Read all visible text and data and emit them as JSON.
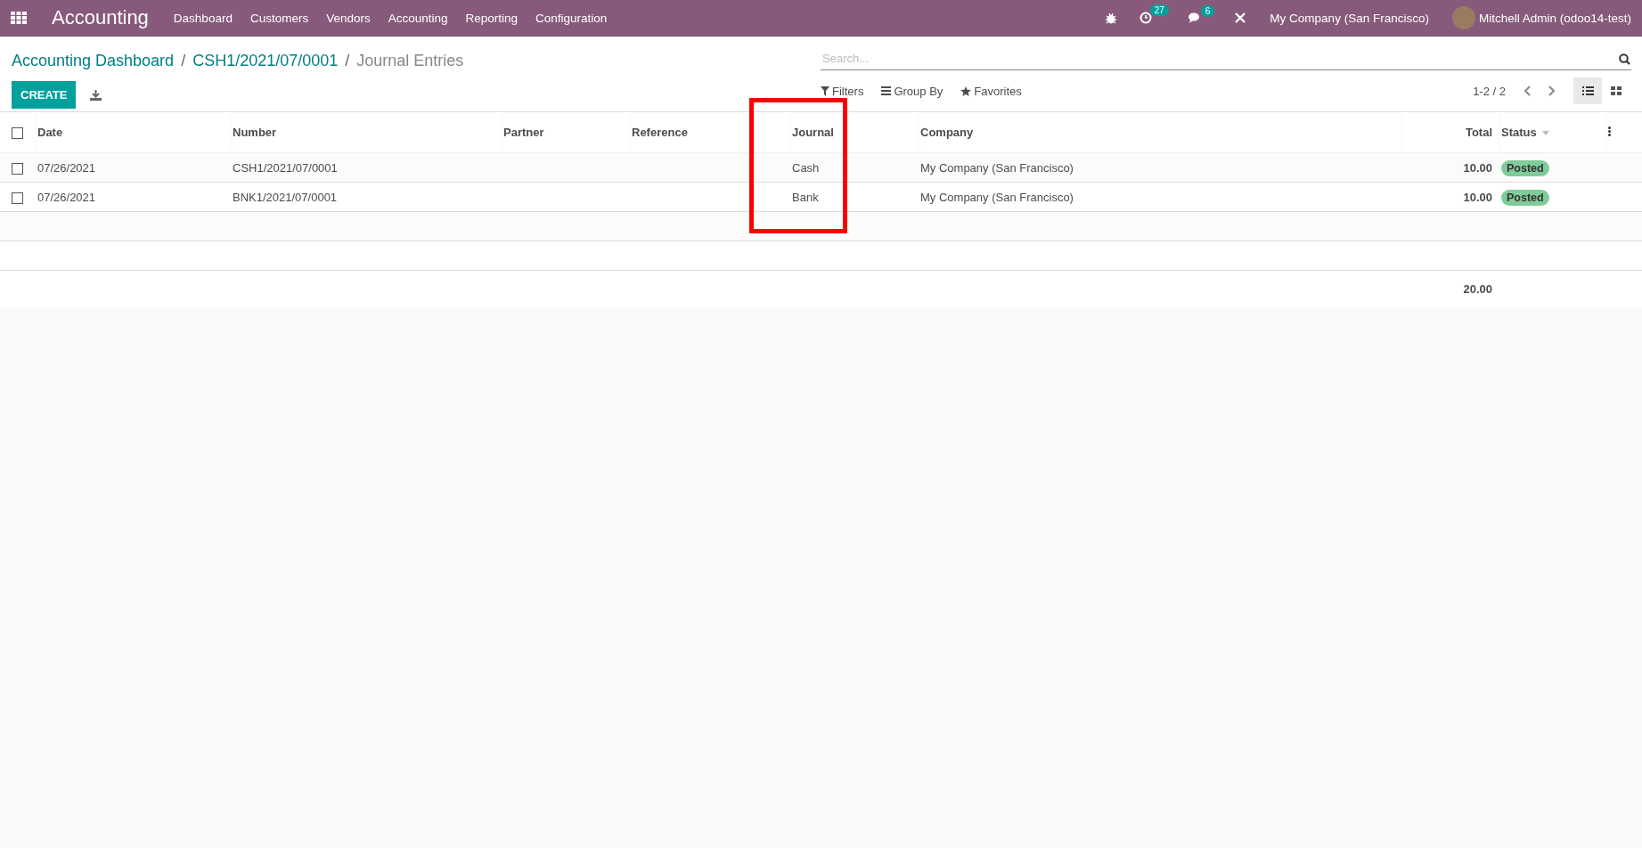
{
  "navbar": {
    "app_title": "Accounting",
    "menu": [
      {
        "label": "Dashboard"
      },
      {
        "label": "Customers"
      },
      {
        "label": "Vendors"
      },
      {
        "label": "Accounting"
      },
      {
        "label": "Reporting"
      },
      {
        "label": "Configuration"
      }
    ],
    "activity_count": "27",
    "message_count": "6",
    "company": "My Company (San Francisco)",
    "user": "Mitchell Admin (odoo14-test)"
  },
  "breadcrumb": {
    "separator": "/",
    "items": [
      {
        "label": "Accounting Dashboard",
        "kind": "link"
      },
      {
        "label": "CSH1/2021/07/0001",
        "kind": "link"
      },
      {
        "label": "Journal Entries",
        "kind": "current"
      }
    ]
  },
  "create_button": "CREATE",
  "search": {
    "placeholder": "Search..."
  },
  "search_options": [
    {
      "label": "Filters",
      "kind": "filter"
    },
    {
      "label": "Group By",
      "kind": "group"
    },
    {
      "label": "Favorites",
      "kind": "star"
    }
  ],
  "pager": "1-2 / 2",
  "views": [
    {
      "kind": "list",
      "selected": true
    },
    {
      "kind": "kanban",
      "selected": false
    }
  ],
  "table": {
    "select_all": false,
    "columns": [
      {
        "label": "Date",
        "kind": "text",
        "sortable": false
      },
      {
        "label": "Number",
        "kind": "text",
        "sortable": false
      },
      {
        "label": "Partner",
        "kind": "text",
        "sortable": false
      },
      {
        "label": "Reference",
        "kind": "text",
        "sortable": false
      },
      {
        "label": "Journal",
        "kind": "text",
        "sortable": false
      },
      {
        "label": "Company",
        "kind": "text",
        "sortable": false
      },
      {
        "label": "Total",
        "kind": "number",
        "sortable": false
      },
      {
        "label": "Status",
        "kind": "text",
        "sortable": true
      }
    ],
    "rows": [
      {
        "checked": false,
        "cells": [
          "07/26/2021",
          "CSH1/2021/07/0001",
          "",
          "",
          "Cash",
          "My Company (San Francisco)",
          "10.00"
        ],
        "status": "Posted"
      },
      {
        "checked": false,
        "cells": [
          "07/26/2021",
          "BNK1/2021/07/0001",
          "",
          "",
          "Bank",
          "My Company (San Francisco)",
          "10.00"
        ],
        "status": "Posted"
      }
    ],
    "footer_total": "20.00"
  }
}
